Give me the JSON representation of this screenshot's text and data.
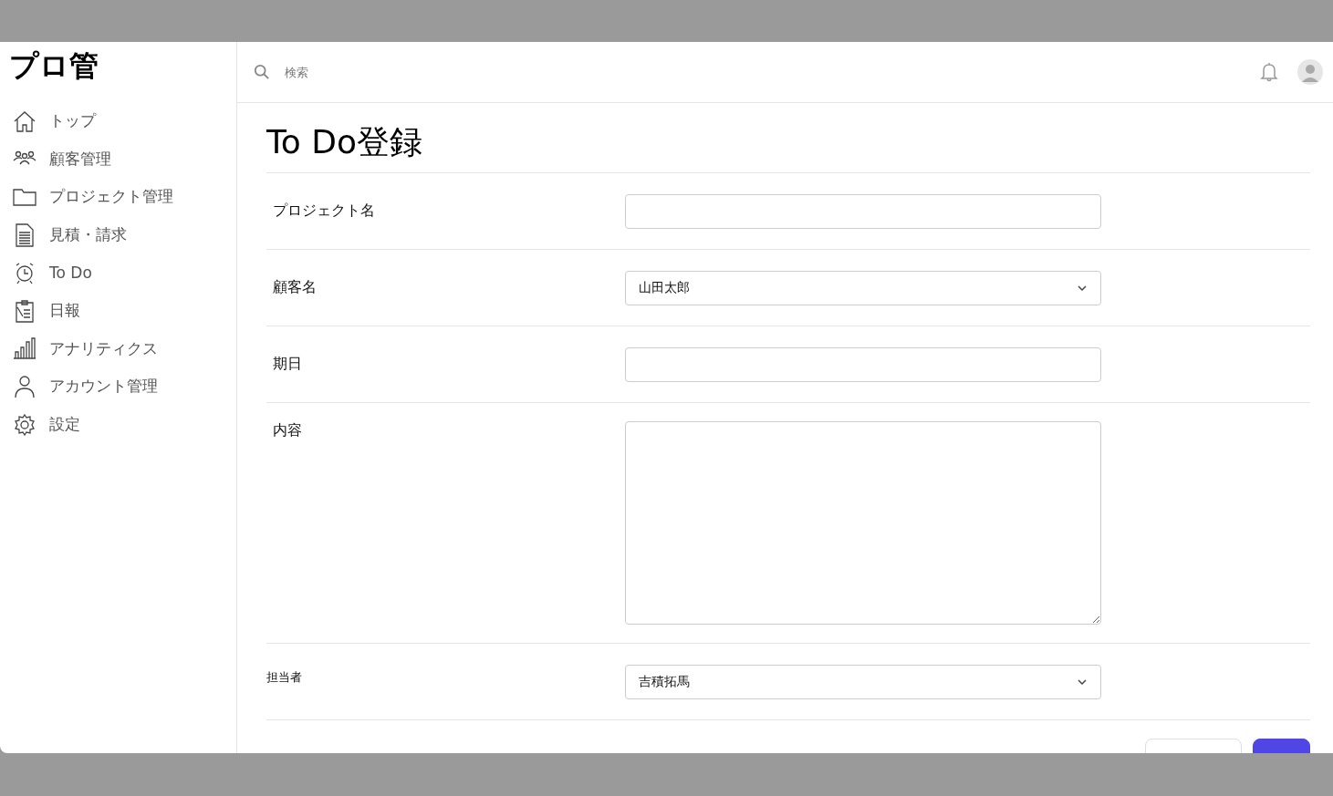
{
  "sidebar": {
    "logo": "プロ管",
    "items": [
      {
        "label": "トップ"
      },
      {
        "label": "顧客管理"
      },
      {
        "label": "プロジェクト管理"
      },
      {
        "label": "見積・請求"
      },
      {
        "label": "To Do"
      },
      {
        "label": "日報"
      },
      {
        "label": "アナリティクス"
      },
      {
        "label": "アカウント管理"
      },
      {
        "label": "設定"
      }
    ]
  },
  "header": {
    "search": {
      "placeholder": "検索"
    }
  },
  "page": {
    "title": "To Do登録",
    "fields": [
      {
        "label": "プロジェクト名",
        "kind": "text"
      },
      {
        "label": "顧客名",
        "kind": "select",
        "value": "山田太郎"
      },
      {
        "label": "期日",
        "kind": "text"
      },
      {
        "label": "内容",
        "kind": "textarea"
      },
      {
        "label": "担当者",
        "kind": "select",
        "value": "吉積拓馬"
      }
    ]
  }
}
